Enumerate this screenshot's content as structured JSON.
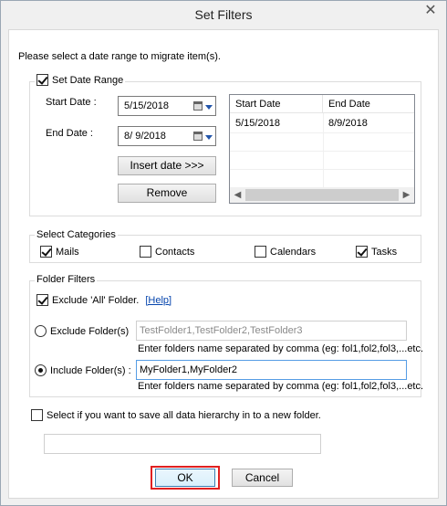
{
  "window": {
    "title": "Set Filters",
    "close_glyph": "✕"
  },
  "intro": "Please select a date range to migrate item(s).",
  "date_range": {
    "set_label": "Set Date Range",
    "set_checked": true,
    "start_label": "Start Date :",
    "start_value": "5/15/2018",
    "end_label": "End Date :",
    "end_value": "8/  9/2018",
    "insert_label": "Insert date >>>",
    "remove_label": "Remove",
    "list": {
      "columns": [
        "Start Date",
        "End Date"
      ],
      "rows": [
        {
          "start": "5/15/2018",
          "end": "8/9/2018"
        }
      ]
    }
  },
  "categories": {
    "legend": "Select Categories",
    "items": [
      {
        "label": "Mails",
        "checked": true
      },
      {
        "label": "Contacts",
        "checked": false
      },
      {
        "label": "Calendars",
        "checked": false
      },
      {
        "label": "Tasks",
        "checked": true
      }
    ]
  },
  "folder_filters": {
    "legend": "Folder Filters",
    "exclude_all_label": "Exclude 'All' Folder.",
    "exclude_all_checked": true,
    "help_link": "[Help]",
    "exclude_label": "Exclude Folder(s)",
    "exclude_value": "TestFolder1,TestFolder2,TestFolder3",
    "exclude_hint": "Enter folders name separated by comma (eg: fol1,fol2,fol3,...etc.",
    "include_label": "Include Folder(s) :",
    "include_value": "MyFolder1,MyFolder2",
    "include_hint": "Enter folders name separated by comma (eg: fol1,fol2,fol3,...etc.",
    "selected": "include"
  },
  "hierarchy": {
    "label": "Select if you want to save all data hierarchy in to a new folder.",
    "checked": false,
    "folder_value": ""
  },
  "buttons": {
    "ok": "OK",
    "cancel": "Cancel"
  },
  "colors": {
    "ok_highlight": "#e02020",
    "link": "#0645ad"
  }
}
